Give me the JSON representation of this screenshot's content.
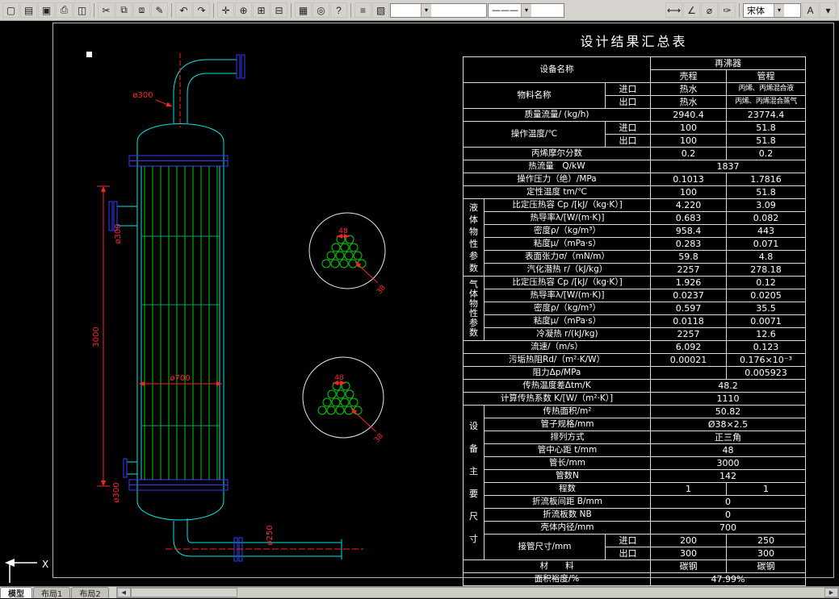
{
  "toolbar": {
    "buttons": [
      {
        "name": "new",
        "glyph": "▢"
      },
      {
        "name": "open",
        "glyph": "▤"
      },
      {
        "name": "save",
        "glyph": "▣"
      },
      {
        "name": "print",
        "glyph": "⎙"
      },
      {
        "name": "print-preview",
        "glyph": "◫"
      },
      {
        "name": "cut",
        "glyph": "✂"
      },
      {
        "name": "copy",
        "glyph": "⧉"
      },
      {
        "name": "paste",
        "glyph": "⧈"
      },
      {
        "name": "match-properties",
        "glyph": "✎"
      },
      {
        "name": "undo",
        "glyph": "↶"
      },
      {
        "name": "redo",
        "glyph": "↷"
      },
      {
        "name": "pan",
        "glyph": "✛"
      },
      {
        "name": "zoom-realtime",
        "glyph": "⊕"
      },
      {
        "name": "zoom-window",
        "glyph": "⊞"
      },
      {
        "name": "zoom-previous",
        "glyph": "⊟"
      },
      {
        "name": "named-views",
        "glyph": "▦"
      },
      {
        "name": "3d-orbit",
        "glyph": "◎"
      },
      {
        "name": "help",
        "glyph": "?"
      },
      {
        "name": "layers",
        "glyph": "≡"
      },
      {
        "name": "layer-previous",
        "glyph": "▧"
      },
      {
        "name": "dim-linear",
        "glyph": "⟷"
      },
      {
        "name": "dim-angular",
        "glyph": "∠"
      },
      {
        "name": "dim-radius",
        "glyph": "⌀"
      },
      {
        "name": "dim-style",
        "glyph": "✑"
      },
      {
        "name": "text",
        "glyph": "A"
      },
      {
        "name": "overflow",
        "glyph": "▾"
      }
    ],
    "layer_field": "",
    "linetype_field": "———",
    "style_field": "宋体"
  },
  "drawing": {
    "top_dia": "ø300",
    "side_dia": "ø300",
    "height": "3000",
    "inner_dia": "ø700",
    "bottom_dia": "ø300",
    "pipe_dia": "ø250",
    "pitch1": "48",
    "od1": "38",
    "pitch2": "48",
    "od2": "38"
  },
  "table": {
    "title": "设计结果汇总表",
    "header": {
      "equip_label": "设备名称",
      "equip_value": "再沸器",
      "shell": "壳程",
      "tube": "管程"
    },
    "material": {
      "label": "物料名称",
      "in": "进口",
      "out": "出口",
      "shell_in": "热水",
      "shell_out": "热水",
      "tube_in": "丙烯、丙烯混合液",
      "tube_out": "丙烯、丙烯混合蒸气"
    },
    "flow": {
      "label": "质量流量/ (kg/h)",
      "shell": "2940.4",
      "tube": "23774.4"
    },
    "temp": {
      "label": "操作温度/℃",
      "in": "进口",
      "out": "出口",
      "shell_in": "100",
      "shell_out": "100",
      "tube_in": "51.8",
      "tube_out": "51.8"
    },
    "molfrac": {
      "label": "丙烯摩尔分数",
      "shell": "0.2",
      "tube": "0.2"
    },
    "heat": {
      "label": "热流量　Q/kW",
      "value": "1837"
    },
    "pressure": {
      "label": "操作压力（绝）/MPa",
      "shell": "0.1013",
      "tube": "1.7816"
    },
    "reftemp": {
      "label": "定性温度 tm/℃",
      "shell": "100",
      "tube": "51.8"
    },
    "liquid": {
      "group": "液体物性参数",
      "rows": [
        {
          "label": "比定压热容 Cp /[kJ/（kg·K）]",
          "shell": "4.220",
          "tube": "3.09"
        },
        {
          "label": "热导率λ/[W/(m·K)]",
          "shell": "0.683",
          "tube": "0.082"
        },
        {
          "label": "密度ρ/（kg/m³）",
          "shell": "958.4",
          "tube": "443"
        },
        {
          "label": "粘度μ/（mPa·s）",
          "shell": "0.283",
          "tube": "0.071"
        },
        {
          "label": "表面张力σ/（mN/m）",
          "shell": "59.8",
          "tube": "4.8"
        },
        {
          "label": "汽化潜热 r/（kJ/kg）",
          "shell": "2257",
          "tube": "278.18"
        }
      ]
    },
    "gas": {
      "group": "气体物性参数",
      "rows": [
        {
          "label": "比定压热容 Cp /[kJ/（kg·K）]",
          "shell": "1.926",
          "tube": "0.12"
        },
        {
          "label": "热导率λ/[W/(m·K)]",
          "shell": "0.0237",
          "tube": "0.0205"
        },
        {
          "label": "密度ρ/（kg/m³）",
          "shell": "0.597",
          "tube": "35.5"
        },
        {
          "label": "粘度μ/（mPa·s）",
          "shell": "0.0118",
          "tube": "0.0071"
        },
        {
          "label": "冷凝热 r/(kJ/kg)",
          "shell": "2257",
          "tube": "12.6"
        }
      ]
    },
    "velocity": {
      "label": "流速/（m/s）",
      "shell": "6.092",
      "tube": "0.123"
    },
    "fouling": {
      "label": "污垢热阻Rd/（m²·K/W）",
      "shell": "0.00021",
      "tube": "0.176×10⁻³"
    },
    "dp": {
      "label": "阻力Δp/MPa",
      "shell": "",
      "tube": "0.005923"
    },
    "lmtd": {
      "label": "传热温度差Δtm/K",
      "value": "48.2"
    },
    "k": {
      "label": "计算传热系数 K/[W/（m²·K）]",
      "value": "1110"
    },
    "size": {
      "group": "设备主要尺寸",
      "rows": [
        {
          "label": "传热面积/m²",
          "value": "50.82"
        },
        {
          "label": "管子规格/mm",
          "value": "Ø38×2.5"
        },
        {
          "label": "排列方式",
          "value": "正三角"
        },
        {
          "label": "管中心距 t/mm",
          "value": "48"
        },
        {
          "label": "管长/mm",
          "value": "3000"
        },
        {
          "label": "管数N",
          "value": "142"
        }
      ],
      "passes": {
        "label": "程数",
        "shell": "1",
        "tube": "1"
      },
      "baffle_space": {
        "label": "折流板间距 B/mm",
        "value": "0"
      },
      "baffle_count": {
        "label": "折流板数 NB",
        "value": "0"
      },
      "shell_id": {
        "label": "壳体内径/mm",
        "value": "700"
      },
      "nozzle": {
        "label": "接管尺寸/mm",
        "in": "进口",
        "out": "出口",
        "shell_in": "200",
        "shell_out": "300",
        "tube_in": "250",
        "tube_out": "300"
      }
    },
    "mat": {
      "label": "材　　料",
      "shell": "碳钢",
      "tube": "碳钢"
    },
    "margin": {
      "label": "面积裕度/%",
      "value": "47.99%"
    }
  },
  "tabs": [
    "模型",
    "布局1",
    "布局2"
  ]
}
